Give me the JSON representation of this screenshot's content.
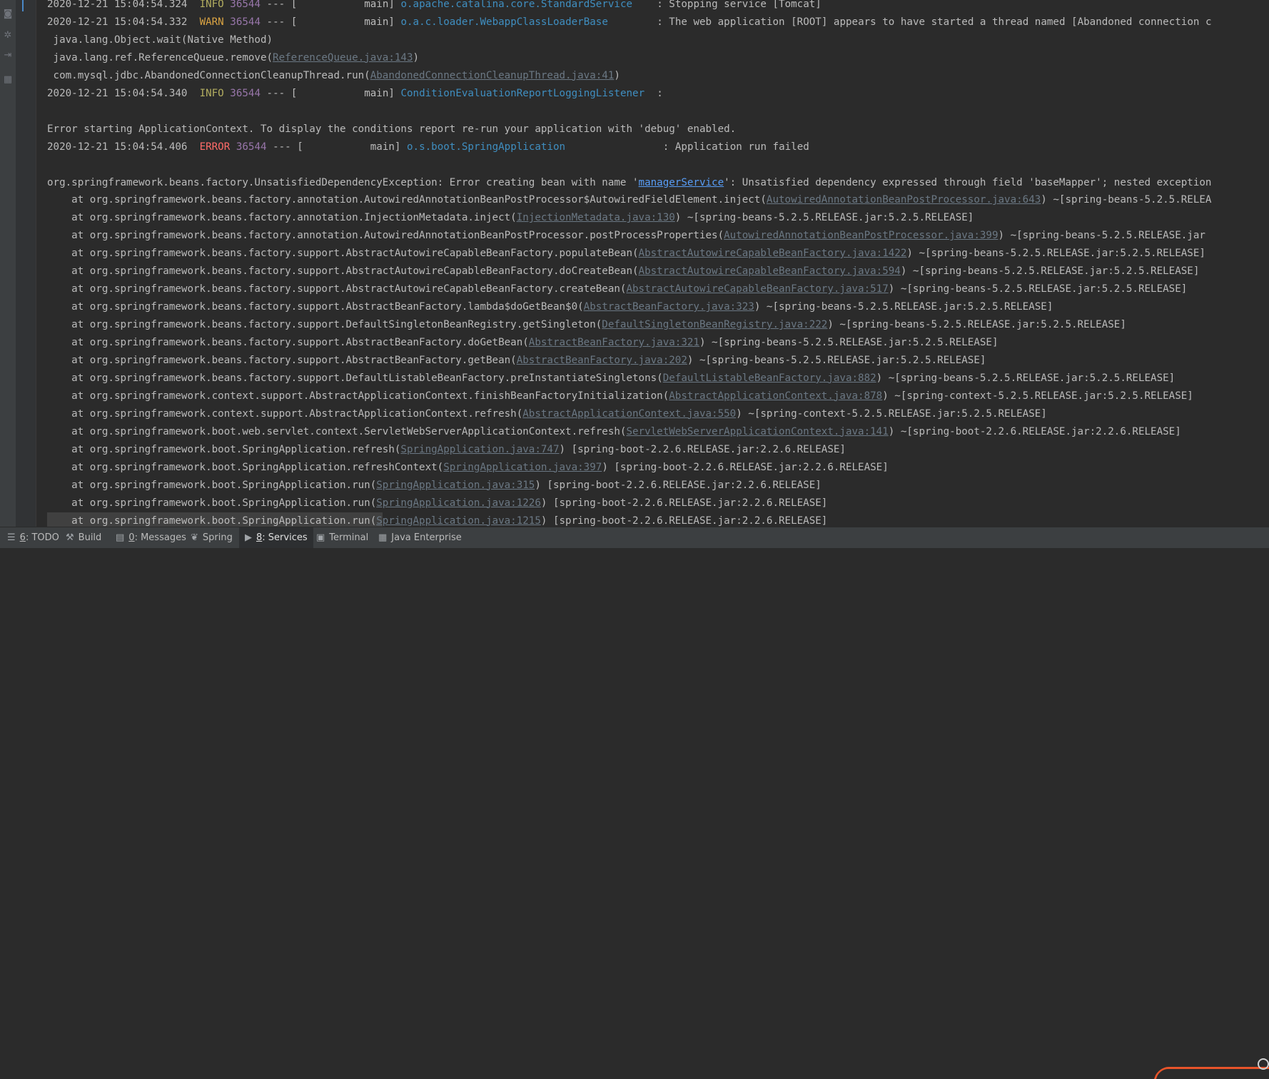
{
  "console_lines": [
    {
      "ts": "2020-12-21 15:04:54.324",
      "level": "INFO",
      "pid": "36544",
      "sep": " --- [           main] ",
      "logger": "o.apache.catalina.core.StandardService   ",
      "msg": " : Stopping service [Tomcat]"
    },
    {
      "ts": "2020-12-21 15:04:54.332",
      "level": "WARN",
      "pid": "36544",
      "sep": " --- [           main] ",
      "logger": "o.a.c.loader.WebappClassLoaderBase       ",
      "msg": " : The web application [ROOT] appears to have started a thread named [Abandoned connection c"
    },
    {
      "text": " java.lang.Object.wait(Native Method)"
    },
    {
      "pre": " java.lang.ref.ReferenceQueue.remove(",
      "link": "ReferenceQueue.java:143",
      "post": ")"
    },
    {
      "pre": " com.mysql.jdbc.AbandonedConnectionCleanupThread.run(",
      "link": "AbandonedConnectionCleanupThread.java:41",
      "post": ")"
    },
    {
      "ts": "2020-12-21 15:04:54.340",
      "level": "INFO",
      "pid": "36544",
      "sep": " --- [           main] ",
      "logger": "ConditionEvaluationReportLoggingListener ",
      "msg": " :"
    },
    {
      "text": ""
    },
    {
      "text": "Error starting ApplicationContext. To display the conditions report re-run your application with 'debug' enabled."
    },
    {
      "ts": "2020-12-21 15:04:54.406",
      "level": "ERROR",
      "pid": "36544",
      "sep": " --- [           main] ",
      "logger": "o.s.boot.SpringApplication               ",
      "msg": " : Application run failed"
    },
    {
      "text": ""
    },
    {
      "pre": "org.springframework.beans.factory.UnsatisfiedDependencyException: Error creating bean with name '",
      "link": "managerService",
      "hi": true,
      "post": "': Unsatisfied dependency expressed through field 'baseMapper'; nested exception"
    },
    {
      "pre": "    at org.springframework.beans.factory.annotation.AutowiredAnnotationBeanPostProcessor$AutowiredFieldElement.inject(",
      "link": "AutowiredAnnotationBeanPostProcessor.java:643",
      "post": ") ~[spring-beans-5.2.5.RELEA"
    },
    {
      "pre": "    at org.springframework.beans.factory.annotation.InjectionMetadata.inject(",
      "link": "InjectionMetadata.java:130",
      "post": ") ~[spring-beans-5.2.5.RELEASE.jar:5.2.5.RELEASE]"
    },
    {
      "pre": "    at org.springframework.beans.factory.annotation.AutowiredAnnotationBeanPostProcessor.postProcessProperties(",
      "link": "AutowiredAnnotationBeanPostProcessor.java:399",
      "post": ") ~[spring-beans-5.2.5.RELEASE.jar"
    },
    {
      "pre": "    at org.springframework.beans.factory.support.AbstractAutowireCapableBeanFactory.populateBean(",
      "link": "AbstractAutowireCapableBeanFactory.java:1422",
      "post": ") ~[spring-beans-5.2.5.RELEASE.jar:5.2.5.RELEASE]"
    },
    {
      "pre": "    at org.springframework.beans.factory.support.AbstractAutowireCapableBeanFactory.doCreateBean(",
      "link": "AbstractAutowireCapableBeanFactory.java:594",
      "post": ") ~[spring-beans-5.2.5.RELEASE.jar:5.2.5.RELEASE]"
    },
    {
      "pre": "    at org.springframework.beans.factory.support.AbstractAutowireCapableBeanFactory.createBean(",
      "link": "AbstractAutowireCapableBeanFactory.java:517",
      "post": ") ~[spring-beans-5.2.5.RELEASE.jar:5.2.5.RELEASE]"
    },
    {
      "pre": "    at org.springframework.beans.factory.support.AbstractBeanFactory.lambda$doGetBean$0(",
      "link": "AbstractBeanFactory.java:323",
      "post": ") ~[spring-beans-5.2.5.RELEASE.jar:5.2.5.RELEASE]"
    },
    {
      "pre": "    at org.springframework.beans.factory.support.DefaultSingletonBeanRegistry.getSingleton(",
      "link": "DefaultSingletonBeanRegistry.java:222",
      "post": ") ~[spring-beans-5.2.5.RELEASE.jar:5.2.5.RELEASE]"
    },
    {
      "pre": "    at org.springframework.beans.factory.support.AbstractBeanFactory.doGetBean(",
      "link": "AbstractBeanFactory.java:321",
      "post": ") ~[spring-beans-5.2.5.RELEASE.jar:5.2.5.RELEASE]"
    },
    {
      "pre": "    at org.springframework.beans.factory.support.AbstractBeanFactory.getBean(",
      "link": "AbstractBeanFactory.java:202",
      "post": ") ~[spring-beans-5.2.5.RELEASE.jar:5.2.5.RELEASE]"
    },
    {
      "pre": "    at org.springframework.beans.factory.support.DefaultListableBeanFactory.preInstantiateSingletons(",
      "link": "DefaultListableBeanFactory.java:882",
      "post": ") ~[spring-beans-5.2.5.RELEASE.jar:5.2.5.RELEASE]"
    },
    {
      "pre": "    at org.springframework.context.support.AbstractApplicationContext.finishBeanFactoryInitialization(",
      "link": "AbstractApplicationContext.java:878",
      "post": ") ~[spring-context-5.2.5.RELEASE.jar:5.2.5.RELEASE]"
    },
    {
      "pre": "    at org.springframework.context.support.AbstractApplicationContext.refresh(",
      "link": "AbstractApplicationContext.java:550",
      "post": ") ~[spring-context-5.2.5.RELEASE.jar:5.2.5.RELEASE]"
    },
    {
      "pre": "    at org.springframework.boot.web.servlet.context.ServletWebServerApplicationContext.refresh(",
      "link": "ServletWebServerApplicationContext.java:141",
      "post": ") ~[spring-boot-2.2.6.RELEASE.jar:2.2.6.RELEASE]"
    },
    {
      "pre": "    at org.springframework.boot.SpringApplication.refresh(",
      "link": "SpringApplication.java:747",
      "post": ") [spring-boot-2.2.6.RELEASE.jar:2.2.6.RELEASE]"
    },
    {
      "pre": "    at org.springframework.boot.SpringApplication.refreshContext(",
      "link": "SpringApplication.java:397",
      "post": ") [spring-boot-2.2.6.RELEASE.jar:2.2.6.RELEASE]"
    },
    {
      "pre": "    at org.springframework.boot.SpringApplication.run(",
      "link": "SpringApplication.java:315",
      "post": ") [spring-boot-2.2.6.RELEASE.jar:2.2.6.RELEASE]"
    },
    {
      "pre": "    at org.springframework.boot.SpringApplication.run(",
      "link": "SpringApplication.java:1226",
      "post": ") [spring-boot-2.2.6.RELEASE.jar:2.2.6.RELEASE]"
    },
    {
      "pre": "    at org.springframework.boot.SpringApplication.run(",
      "link": "SpringApplication.java:1215",
      "post": ") [spring-boot-2.2.6.RELEASE.jar:2.2.6.RELEASE]"
    }
  ],
  "left_tools": [
    {
      "name": "camera-icon",
      "glyph": "◙"
    },
    {
      "name": "settings-icon",
      "glyph": "✲"
    },
    {
      "name": "login-icon",
      "glyph": "⇥"
    },
    {
      "name": "layout-icon",
      "glyph": "▦"
    }
  ],
  "status_tabs": [
    {
      "name": "tab-todo",
      "icon": "☰",
      "icon_name": "list-icon",
      "mnemonic": "6",
      "label": ": TODO"
    },
    {
      "name": "tab-build",
      "icon": "⚒",
      "icon_name": "hammer-icon",
      "mnemonic": "",
      "label": "Build"
    },
    {
      "name": "tab-messages",
      "icon": "▤",
      "icon_name": "messages-icon",
      "mnemonic": "0",
      "label": ": Messages"
    },
    {
      "name": "tab-spring",
      "icon": "❦",
      "icon_name": "spring-leaf-icon",
      "mnemonic": "",
      "label": "Spring"
    },
    {
      "name": "tab-services",
      "icon": "▶",
      "icon_name": "services-icon",
      "mnemonic": "8",
      "label": ": Services",
      "active": true
    },
    {
      "name": "tab-terminal",
      "icon": "▣",
      "icon_name": "terminal-icon",
      "mnemonic": "",
      "label": "Terminal"
    },
    {
      "name": "tab-java-enterprise",
      "icon": "▦",
      "icon_name": "java-enterprise-icon",
      "mnemonic": "",
      "label": "Java Enterprise"
    }
  ],
  "colors": {
    "background": "#2b2b2b",
    "info": "#b3ae60",
    "warn": "#d9a343",
    "error": "#ff6b68",
    "pid": "#9876aa",
    "logger": "#3f8ec0",
    "link": "#6b7884"
  }
}
